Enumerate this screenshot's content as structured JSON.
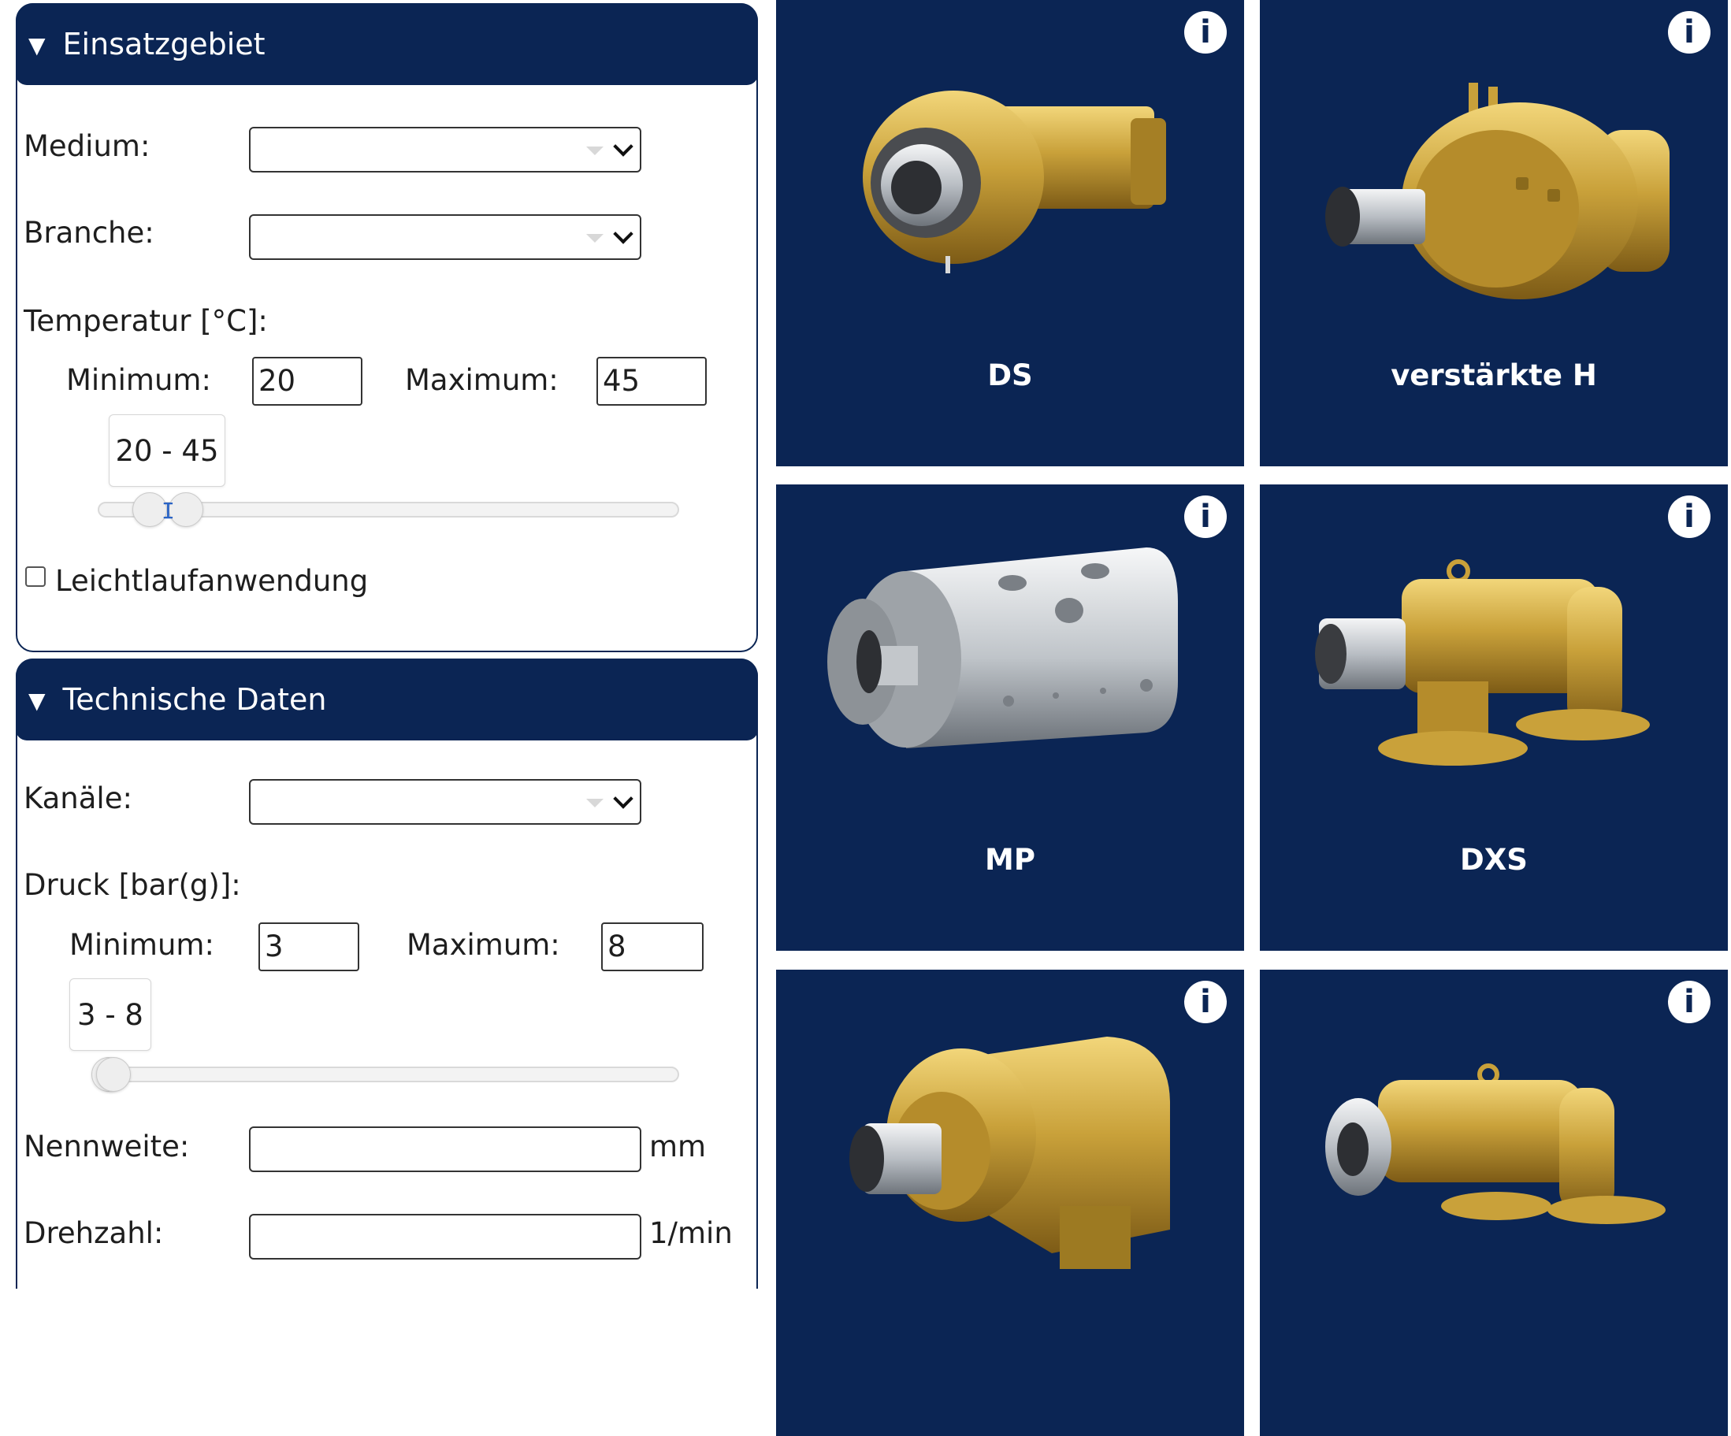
{
  "filters": {
    "einsatzgebiet": {
      "title": "Einsatzgebiet",
      "medium_label": "Medium:",
      "medium_value": "",
      "branche_label": "Branche:",
      "branche_value": "",
      "temperatur_label": "Temperatur [°C]:",
      "temp_min_label": "Minimum:",
      "temp_min_value": "20",
      "temp_max_label": "Maximum:",
      "temp_max_value": "45",
      "temp_range_text": "20 - 45",
      "leichtlauf_label": "Leichtlaufanwendung",
      "leichtlauf_checked": false
    },
    "technische_daten": {
      "title": "Technische Daten",
      "kanaele_label": "Kanäle:",
      "kanaele_value": "",
      "druck_label": "Druck [bar(g)]:",
      "druck_min_label": "Minimum:",
      "druck_min_value": "3",
      "druck_max_label": "Maximum:",
      "druck_max_value": "8",
      "druck_range_text": "3 - 8",
      "nennweite_label": "Nennweite:",
      "nennweite_value": "",
      "nennweite_unit": "mm",
      "drehzahl_label": "Drehzahl:",
      "drehzahl_value": "",
      "drehzahl_unit": "1/min"
    }
  },
  "products": [
    {
      "name": "DS",
      "info_label": "i",
      "finish": "brass"
    },
    {
      "name": "verstärkte H",
      "info_label": "i",
      "finish": "brass"
    },
    {
      "name": "MP",
      "info_label": "i",
      "finish": "steel"
    },
    {
      "name": "DXS",
      "info_label": "i",
      "finish": "brass"
    },
    {
      "name": "",
      "info_label": "i",
      "finish": "brass"
    },
    {
      "name": "",
      "info_label": "i",
      "finish": "brass"
    }
  ],
  "colors": {
    "navy": "#0b2554",
    "brass": "#c9a13a",
    "steel": "#c8ccd1"
  }
}
